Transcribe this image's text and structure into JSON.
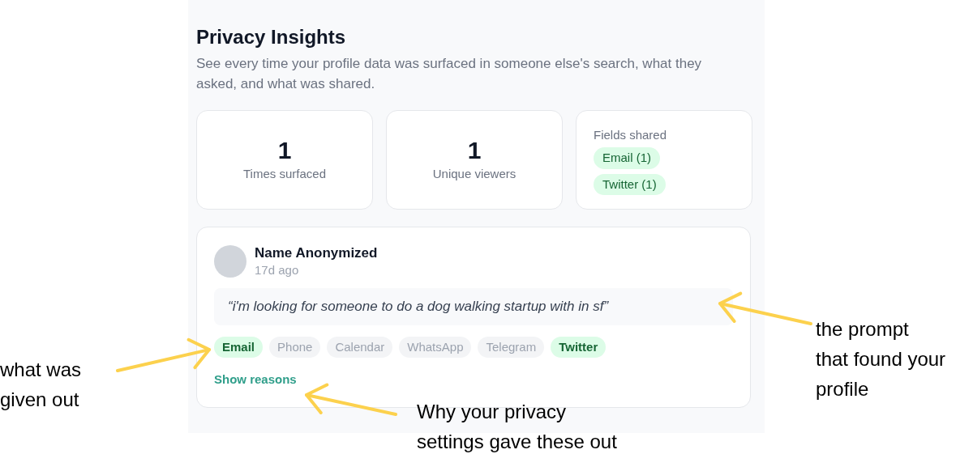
{
  "panel": {
    "title": "Privacy Insights",
    "description": "See every time your profile data was surfaced in someone else's search, what they asked, and what was shared.",
    "stats": [
      {
        "value": "1",
        "label": "Times surfaced"
      },
      {
        "value": "1",
        "label": "Unique viewers"
      }
    ],
    "fields_shared": {
      "label": "Fields shared",
      "chips": [
        "Email (1)",
        "Twitter (1)"
      ]
    },
    "activity": {
      "name": "Name Anonymized",
      "time": "17d ago",
      "prompt": "“i'm looking for someone to do a dog walking startup with in sf”",
      "fields": [
        {
          "label": "Email",
          "shared": true
        },
        {
          "label": "Phone",
          "shared": false
        },
        {
          "label": "Calendar",
          "shared": false
        },
        {
          "label": "WhatsApp",
          "shared": false
        },
        {
          "label": "Telegram",
          "shared": false
        },
        {
          "label": "Twitter",
          "shared": true
        }
      ],
      "link": "Show reasons"
    }
  },
  "annotations": [
    {
      "lines": [
        "the prompt",
        "that found your",
        "profile"
      ]
    },
    {
      "lines": [
        "what was",
        "given out"
      ]
    },
    {
      "lines": [
        "Why your privacy",
        "settings gave these out"
      ]
    }
  ]
}
